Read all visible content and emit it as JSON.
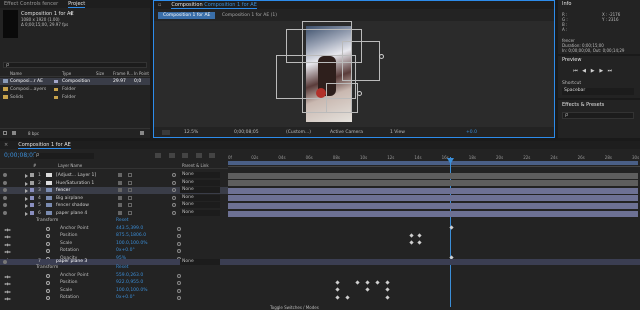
{
  "project": {
    "tabs": [
      "Effect Controls fencer",
      "Project"
    ],
    "comp_name": "Composition 1 for AE",
    "comp_dims": "1080 x 1920 (1.00)",
    "comp_duration": "Δ 0;00;15;00, 29.97 fps",
    "search_placeholder": "ρ",
    "columns": {
      "name": "Name",
      "type": "Type",
      "size": "Size",
      "frame_rate": "Frame R...",
      "in_point": "In Point"
    },
    "items": [
      {
        "name": "Composi...r AE",
        "type": "Composition",
        "size": "",
        "frame_rate": "29.97",
        "in_point": "0;0"
      },
      {
        "name": "Composi...ayers",
        "type": "Folder",
        "size": "",
        "frame_rate": "",
        "in_point": ""
      },
      {
        "name": "Solids",
        "type": "Folder",
        "size": "",
        "frame_rate": "",
        "in_point": ""
      }
    ],
    "bpc": "8 bpc"
  },
  "viewer": {
    "tab_prefix": "Composition",
    "tab_name": "Composition 1 for AE",
    "crumbs": [
      "Composition 1 for AE",
      "Composition 1 for AE (1)"
    ],
    "zoom": "12.5%",
    "timecode": "0;00;08;05",
    "resolution": "(Custom...)",
    "camera": "Active Camera",
    "views": "1 View",
    "exposure": "+0.0"
  },
  "info": {
    "tab": "Info",
    "r": "R :",
    "g": "G :",
    "b": "B :",
    "a": "A :",
    "x": "X : -2176",
    "y": "Y : 2316",
    "layer_name": "fencer",
    "duration": "Duration: 0;00;15;00",
    "in_out": "In: 0;00;00;00, Out: 0;00;14;29"
  },
  "preview": {
    "tab": "Preview"
  },
  "shortcut": {
    "label": "Shortcut",
    "value": "Spacebar"
  },
  "effects": {
    "tab": "Effects & Presets",
    "search": "ρ"
  },
  "timeline": {
    "tab": "Composition 1 for AE",
    "timecode": "0;00;08;05",
    "search": "ρ",
    "ticks": [
      "0f",
      "02s",
      "04s",
      "06s",
      "08s",
      "10s",
      "12s",
      "14s",
      "16s",
      "18s",
      "20s",
      "22s",
      "24s",
      "26s",
      "28s",
      "30s"
    ],
    "col_num": "#",
    "col_layer": "Layer Name",
    "col_parent": "Parent & Link",
    "layers": [
      {
        "num": "1",
        "name": "[Adjust... Layer 1]",
        "parent": "None",
        "color": "#a0a0a0"
      },
      {
        "num": "2",
        "name": "Hue/Saturation 1",
        "parent": "None",
        "color": "#a0a0a0"
      },
      {
        "num": "3",
        "name": "fencer",
        "parent": "None",
        "color": "#8a8fc0"
      },
      {
        "num": "4",
        "name": "Big airplane",
        "parent": "None",
        "color": "#8a8fc0"
      },
      {
        "num": "5",
        "name": "fencer shadow",
        "parent": "None",
        "color": "#8a8fc0"
      },
      {
        "num": "6",
        "name": "paper plane 4",
        "parent": "None",
        "color": "#8a8fc0"
      }
    ],
    "transform1": {
      "label": "Transform",
      "reset": "Reset",
      "props": [
        {
          "name": "Anchor Point",
          "value": "443.5,399.0"
        },
        {
          "name": "Position",
          "value": "875.5,1806.0"
        },
        {
          "name": "Scale",
          "value": "100.0,100.0%"
        },
        {
          "name": "Rotation",
          "value": "0x+0.0°"
        },
        {
          "name": "Opacity",
          "value": "95%"
        }
      ]
    },
    "layer7": {
      "num": "7",
      "name": "paper plane 3",
      "parent": "None"
    },
    "transform2": {
      "label": "Transform",
      "reset": "Reset",
      "props": [
        {
          "name": "Anchor Point",
          "value": "559.0,263.0"
        },
        {
          "name": "Position",
          "value": "922.0,955.0"
        },
        {
          "name": "Scale",
          "value": "100.0,100.0%"
        },
        {
          "name": "Rotation",
          "value": "0x+0.0°"
        }
      ]
    },
    "footer": "Toggle Switches / Modes"
  }
}
